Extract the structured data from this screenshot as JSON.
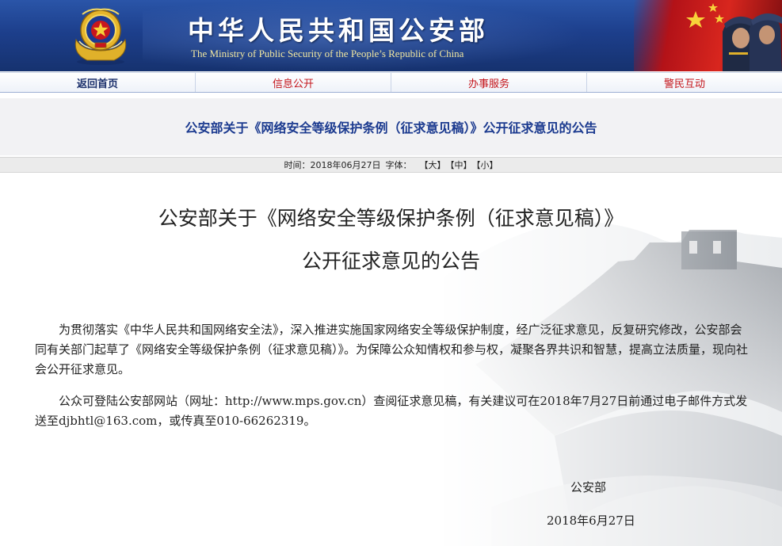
{
  "header": {
    "title_cn": "中华人民共和国公安部",
    "title_en": "The Ministry of Public Security of the People’s Republic of China"
  },
  "nav": {
    "items": [
      {
        "label": "返回首页"
      },
      {
        "label": "信息公开"
      },
      {
        "label": "办事服务"
      },
      {
        "label": "警民互动"
      }
    ]
  },
  "strip_title": "公安部关于《网络安全等级保护条例（征求意见稿）》公开征求意见的公告",
  "meta": {
    "time_label": "时间：",
    "date": "2018年06月27日",
    "font_label": "字体：",
    "font_large": "【大】",
    "font_medium": "【中】",
    "font_small": "【小】"
  },
  "article": {
    "title_line1": "公安部关于《网络安全等级保护条例（征求意见稿）》",
    "title_line2": "公开征求意见的公告",
    "paragraphs": [
      "为贯彻落实《中华人民共和国网络安全法》，深入推进实施国家网络安全等级保护制度，经广泛征求意见，反复研究修改，公安部会同有关部门起草了《网络安全等级保护条例（征求意见稿）》。为保障公众知情权和参与权，凝聚各界共识和智慧，提高立法质量，现向社会公开征求意见。",
      "公众可登陆公安部网站（网址：http://www.mps.gov.cn）查阅征求意见稿，有关建议可在2018年7月27日前通过电子邮件方式发送至djbhtl@163.com，或传真至010-66262319。"
    ],
    "signature_org": "公安部",
    "signature_date": "2018年6月27日"
  },
  "colors": {
    "banner_blue": "#1d3f8c",
    "title_blue": "#1b3a8f",
    "nav_red": "#c4141a",
    "flag_red": "#d8261e"
  }
}
